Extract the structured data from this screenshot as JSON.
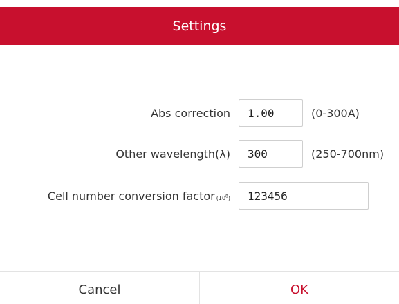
{
  "dialog": {
    "title": "Settings",
    "accent_color": "#c8102e"
  },
  "fields": {
    "abs_correction": {
      "label": "Abs correction",
      "value": "1.00",
      "range": "(0-300A)"
    },
    "other_wavelength": {
      "label": "Other wavelength(λ)",
      "value": "300",
      "range": "(250-700nm)"
    },
    "cell_factor": {
      "label": "Cell number conversion factor",
      "unit_base": "(10",
      "unit_exp": "8",
      "unit_close": ")",
      "value": "123456"
    }
  },
  "footer": {
    "cancel_label": "Cancel",
    "ok_label": "OK"
  }
}
